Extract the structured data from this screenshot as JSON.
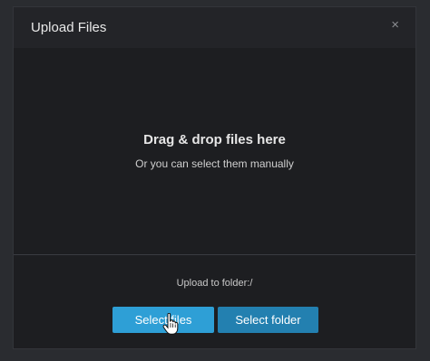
{
  "modal": {
    "title": "Upload Files",
    "close_glyph": "×"
  },
  "drop_zone": {
    "title": "Drag & drop files here",
    "subtitle": "Or you can select them manually"
  },
  "footer": {
    "folder_line": "Upload to folder:/",
    "select_files_label": "Select files",
    "select_folder_label": "Select folder"
  },
  "colors": {
    "primary_button": "#2e9fd6",
    "secondary_button": "#2380b0",
    "modal_background": "#1d1e21"
  },
  "icons": {
    "cursor": "hand-pointer-icon"
  }
}
